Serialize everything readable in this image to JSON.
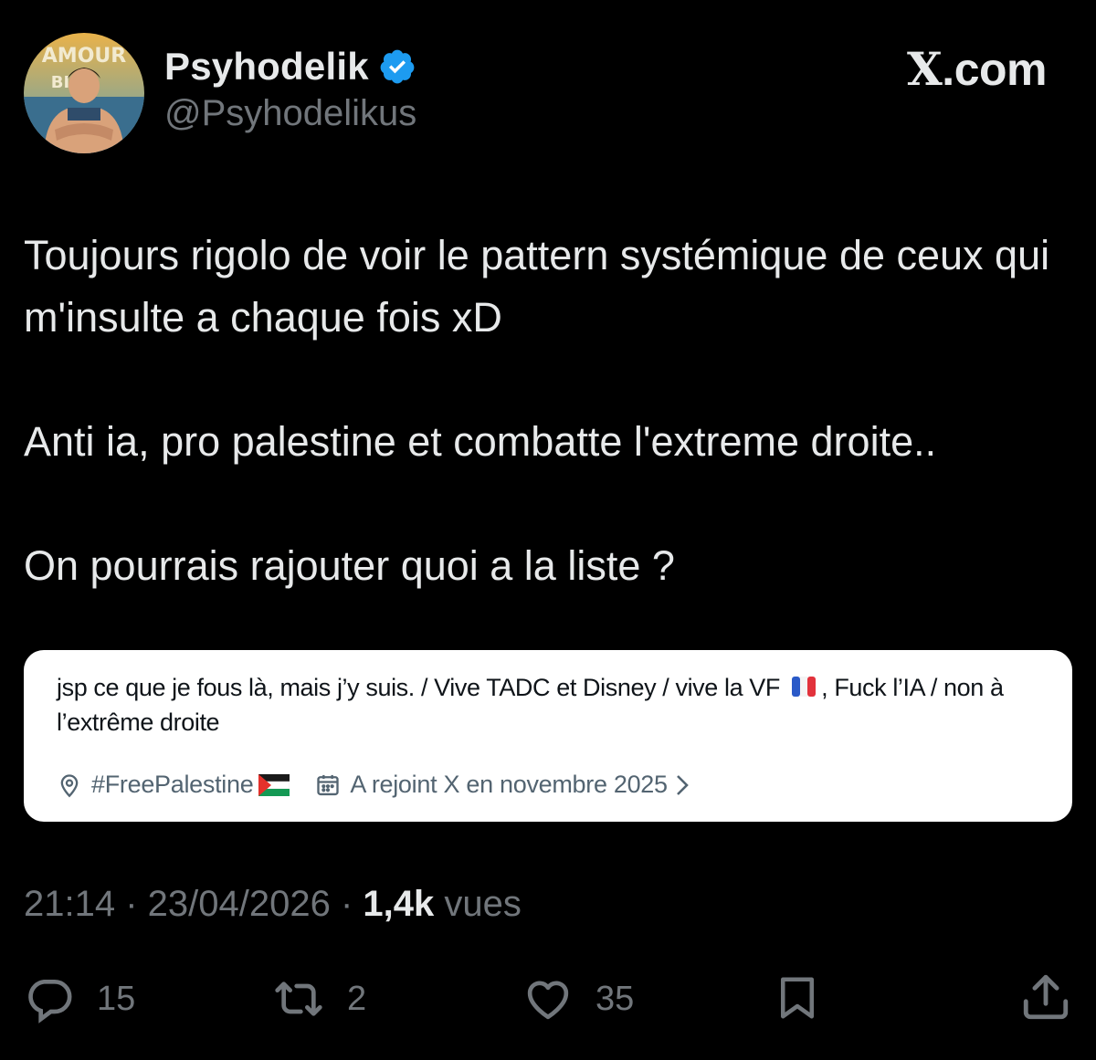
{
  "author": {
    "display_name": "Psyhodelik",
    "handle": "@Psyhodelikus",
    "verified": true,
    "avatar_lettering": "AMOUR BIÈRE"
  },
  "brand": {
    "x_letter": "X",
    "suffix": ".com"
  },
  "tweet": {
    "paragraphs": [
      "Toujours rigolo de voir le pattern systémique de ceux qui m'insulte a chaque fois xD",
      "Anti ia, pro palestine et combatte l'extreme droite..",
      "On pourrais rajouter quoi a la liste ?"
    ]
  },
  "bio_card": {
    "text_before_flag": "jsp ce que je fous là, mais j’y suis. / Vive TADC et Disney / vive la VF",
    "text_after_flag": ", Fuck l’IA / non à l’extrême droite",
    "location": "#FreePalestine",
    "joined": "A rejoint X en novembre 2025"
  },
  "meta": {
    "time": "21:14",
    "separator": " · ",
    "date": "23/04/2026",
    "views_count": "1,4k",
    "views_label": "vues"
  },
  "actions": {
    "replies": "15",
    "reposts": "2",
    "likes": "35"
  },
  "colors": {
    "background": "#000000",
    "text_primary": "#e7e9ea",
    "text_secondary": "#71767b",
    "verified_badge": "#1d9bf0",
    "card_background": "#ffffff"
  },
  "icons": [
    "verified-badge-icon",
    "location-pin-icon",
    "calendar-icon",
    "chevron-right-icon",
    "reply-icon",
    "repost-icon",
    "like-icon",
    "bookmark-icon",
    "share-icon",
    "flag-france-icon",
    "flag-palestine-icon"
  ]
}
